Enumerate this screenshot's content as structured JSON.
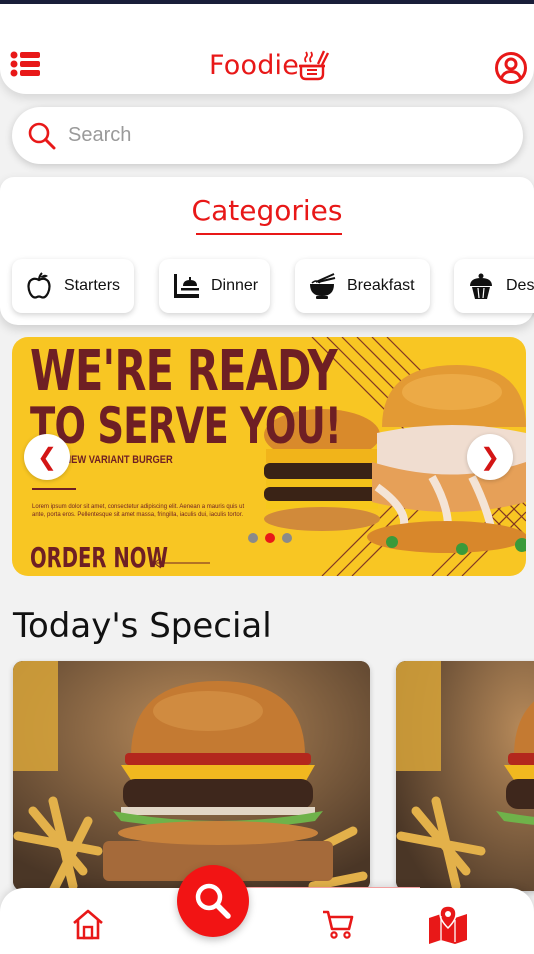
{
  "header": {
    "brand": "Foodie",
    "icons": {
      "menu": "list-icon",
      "brand": "food-bowl-icon",
      "account": "user-circle-icon"
    }
  },
  "search": {
    "placeholder": "Search",
    "value": ""
  },
  "categories": {
    "title": "Categories",
    "items": [
      {
        "label": "Starters",
        "icon": "apple-icon"
      },
      {
        "label": "Dinner",
        "icon": "dining-table-icon"
      },
      {
        "label": "Breakfast",
        "icon": "noodle-bowl-icon"
      },
      {
        "label": "Des",
        "icon": "cupcake-icon"
      }
    ]
  },
  "banner": {
    "headline_1": "WE'RE READY",
    "headline_2": "TO SERVE YOU!",
    "subtitle": "R NEW VARIANT BURGER",
    "fine_print": "Lorem ipsum dolor sit amet, consectetur adipiscing elit. Aenean a mauris quis ut ante, porta eros. Pellentesque sit amet massa, fringilla, iaculis dui, iaculis tortor.",
    "cta": "ORDER NOW",
    "prev": "❮",
    "next": "❯",
    "slides": 3,
    "active_slide": 2
  },
  "todays_special": {
    "title": "Today's Special",
    "cards": 2
  },
  "bottom_nav": {
    "items": [
      "home-icon",
      "search-icon",
      "cart-icon",
      "map-icon"
    ]
  },
  "colors": {
    "accent": "#e81818",
    "banner_bg": "#f8c623",
    "banner_text": "#6e1f24"
  }
}
